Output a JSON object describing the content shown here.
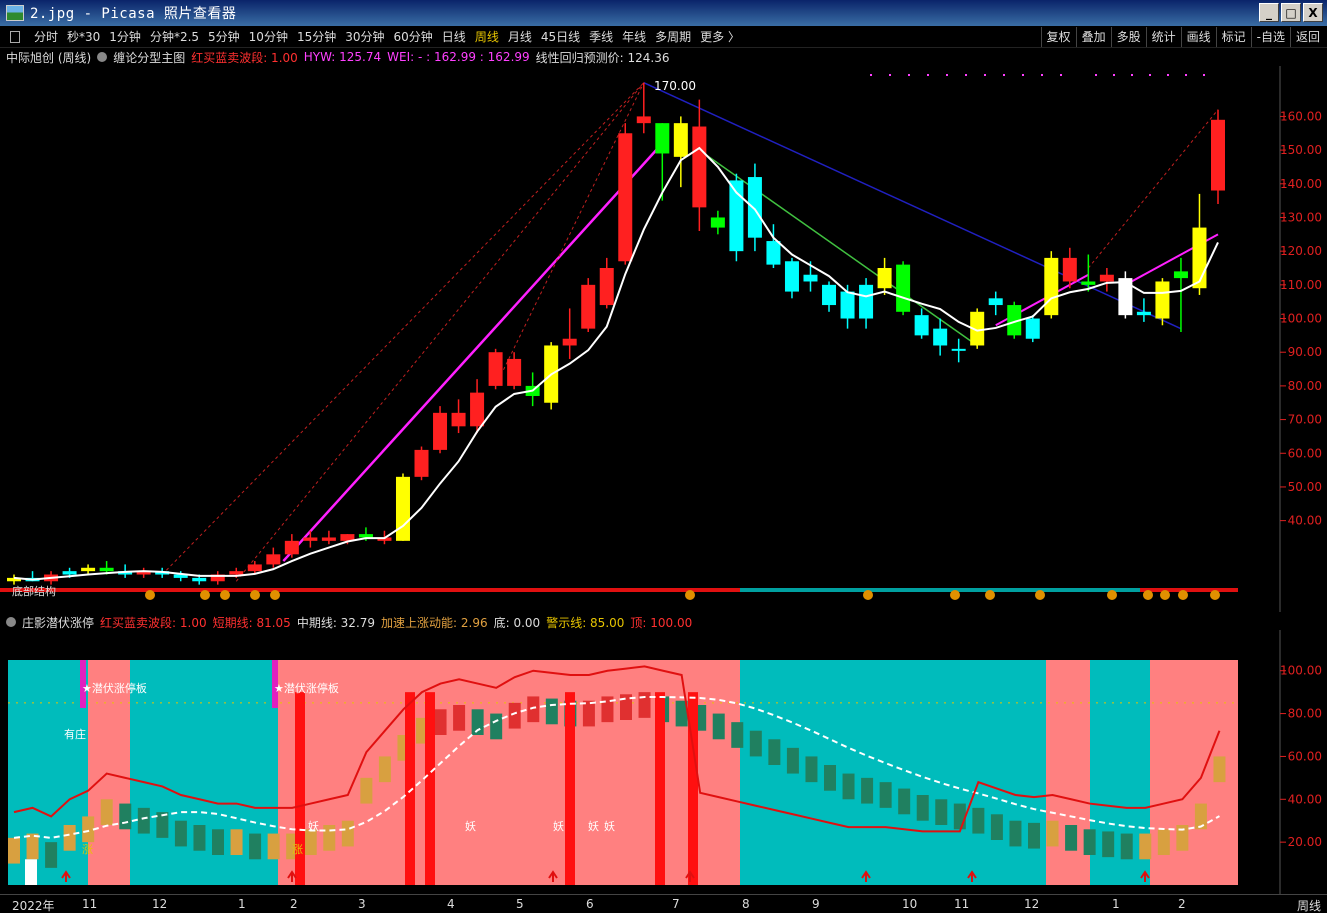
{
  "window": {
    "title": "2.jpg - Picasa 照片查看器",
    "minimize": "_",
    "maximize": "□",
    "close": "X"
  },
  "toolbar": {
    "periods": [
      "分时",
      "秒*30",
      "1分钟",
      "分钟*2.5",
      "5分钟",
      "10分钟",
      "15分钟",
      "30分钟",
      "60分钟",
      "日线",
      "周线",
      "月线",
      "45日线",
      "季线",
      "年线",
      "多周期",
      "更多 〉"
    ],
    "active_period": "周线",
    "right_tools": [
      "复权",
      "叠加",
      "多股",
      "统计",
      "画线",
      "标记",
      "-自选",
      "返回"
    ]
  },
  "main_info": {
    "stock": "中际旭创 (周线)",
    "indicator": "缠论分型主图",
    "hongmai": "红买蓝卖波段: 1.00",
    "hyw": "HYW: 125.74",
    "wei": "WEI: - : 162.99 : 162.99",
    "regress": "线性回归预测价: 124.36",
    "peak_label": "170.00"
  },
  "sub_info": {
    "indicator": "庄影潜伏涨停",
    "hongmai": "红买蓝卖波段: 1.00",
    "short": "短期线: 81.05",
    "mid": "中期线: 32.79",
    "accel": "加速上涨动能: 2.96",
    "bottom": "底: 0.00",
    "warn": "警示线: 85.00",
    "top": "顶: 100.00",
    "labels": [
      "★潜伏涨停板",
      "★潜伏涨停板",
      "有庄",
      "妖",
      "妖",
      "妖",
      "妖",
      "妖",
      "涨",
      "涨"
    ]
  },
  "colors": {
    "up": "#ff2020",
    "down": "#00ffff",
    "yellow": "#ffff00",
    "green": "#00ff00",
    "white": "#ffffff",
    "magenta": "#ff00ff",
    "cyan_bg": "#00bcbc",
    "pink_bg": "#ff8080"
  },
  "main_axis": [
    "160.00",
    "150.00",
    "140.00",
    "130.00",
    "120.00",
    "110.00",
    "100.00",
    "90.00",
    "80.00",
    "70.00",
    "60.00",
    "50.00",
    "40.00"
  ],
  "sub_axis": [
    "100.00",
    "80.00",
    "60.00",
    "40.00",
    "20.00"
  ],
  "x_axis": [
    "2022年",
    "11",
    "12",
    "1",
    "2",
    "3",
    "4",
    "5",
    "6",
    "7",
    "8",
    "9",
    "10",
    "11",
    "12",
    "1",
    "2"
  ],
  "period_label": "周线",
  "bottom_struct_label": "底部结构",
  "candles": [
    {
      "o": 22,
      "h": 24,
      "l": 21,
      "c": 23,
      "col": "yellow"
    },
    {
      "o": 23,
      "h": 25,
      "l": 22,
      "c": 22,
      "col": "down"
    },
    {
      "o": 22,
      "h": 25,
      "l": 21,
      "c": 24,
      "col": "up"
    },
    {
      "o": 24,
      "h": 26,
      "l": 23,
      "c": 25,
      "col": "down"
    },
    {
      "o": 25,
      "h": 27,
      "l": 24,
      "c": 26,
      "col": "yellow"
    },
    {
      "o": 26,
      "h": 28,
      "l": 24,
      "c": 25,
      "col": "green"
    },
    {
      "o": 25,
      "h": 27,
      "l": 23,
      "c": 24,
      "col": "down"
    },
    {
      "o": 24,
      "h": 26,
      "l": 23,
      "c": 25,
      "col": "up"
    },
    {
      "o": 25,
      "h": 26,
      "l": 23,
      "c": 24,
      "col": "down"
    },
    {
      "o": 24,
      "h": 25,
      "l": 22,
      "c": 23,
      "col": "down"
    },
    {
      "o": 23,
      "h": 24,
      "l": 21,
      "c": 22,
      "col": "down"
    },
    {
      "o": 22,
      "h": 25,
      "l": 21,
      "c": 24,
      "col": "up"
    },
    {
      "o": 24,
      "h": 26,
      "l": 23,
      "c": 25,
      "col": "up"
    },
    {
      "o": 25,
      "h": 28,
      "l": 24,
      "c": 27,
      "col": "up"
    },
    {
      "o": 27,
      "h": 32,
      "l": 26,
      "c": 30,
      "col": "up"
    },
    {
      "o": 30,
      "h": 36,
      "l": 29,
      "c": 34,
      "col": "up"
    },
    {
      "o": 34,
      "h": 37,
      "l": 32,
      "c": 35,
      "col": "up"
    },
    {
      "o": 35,
      "h": 37,
      "l": 33,
      "c": 34,
      "col": "up"
    },
    {
      "o": 34,
      "h": 36,
      "l": 33,
      "c": 36,
      "col": "up"
    },
    {
      "o": 36,
      "h": 38,
      "l": 34,
      "c": 35,
      "col": "green"
    },
    {
      "o": 35,
      "h": 37,
      "l": 33,
      "c": 34,
      "col": "up"
    },
    {
      "o": 34,
      "h": 54,
      "l": 34,
      "c": 53,
      "col": "yellow"
    },
    {
      "o": 53,
      "h": 62,
      "l": 52,
      "c": 61,
      "col": "up"
    },
    {
      "o": 61,
      "h": 74,
      "l": 60,
      "c": 72,
      "col": "up"
    },
    {
      "o": 72,
      "h": 76,
      "l": 66,
      "c": 68,
      "col": "up"
    },
    {
      "o": 68,
      "h": 82,
      "l": 66,
      "c": 78,
      "col": "up"
    },
    {
      "o": 80,
      "h": 91,
      "l": 79,
      "c": 90,
      "col": "up"
    },
    {
      "o": 88,
      "h": 90,
      "l": 79,
      "c": 80,
      "col": "up"
    },
    {
      "o": 80,
      "h": 84,
      "l": 74,
      "c": 77,
      "col": "green"
    },
    {
      "o": 75,
      "h": 93,
      "l": 73,
      "c": 92,
      "col": "yellow"
    },
    {
      "o": 92,
      "h": 103,
      "l": 88,
      "c": 94,
      "col": "up"
    },
    {
      "o": 97,
      "h": 112,
      "l": 96,
      "c": 110,
      "col": "up"
    },
    {
      "o": 104,
      "h": 118,
      "l": 103,
      "c": 115,
      "col": "up"
    },
    {
      "o": 117,
      "h": 158,
      "l": 116,
      "c": 155,
      "col": "up"
    },
    {
      "o": 160,
      "h": 170,
      "l": 155,
      "c": 158,
      "col": "up"
    },
    {
      "o": 158,
      "h": 158,
      "l": 135,
      "c": 149,
      "col": "green"
    },
    {
      "o": 148,
      "h": 160,
      "l": 139,
      "c": 158,
      "col": "yellow"
    },
    {
      "o": 157,
      "h": 165,
      "l": 126,
      "c": 133,
      "col": "up"
    },
    {
      "o": 130,
      "h": 132,
      "l": 125,
      "c": 127,
      "col": "green"
    },
    {
      "o": 141,
      "h": 143,
      "l": 117,
      "c": 120,
      "col": "down"
    },
    {
      "o": 142,
      "h": 146,
      "l": 120,
      "c": 124,
      "col": "down"
    },
    {
      "o": 123,
      "h": 128,
      "l": 115,
      "c": 116,
      "col": "down"
    },
    {
      "o": 117,
      "h": 118,
      "l": 106,
      "c": 108,
      "col": "down"
    },
    {
      "o": 113,
      "h": 117,
      "l": 108,
      "c": 111,
      "col": "down"
    },
    {
      "o": 110,
      "h": 111,
      "l": 102,
      "c": 104,
      "col": "down"
    },
    {
      "o": 108,
      "h": 110,
      "l": 97,
      "c": 100,
      "col": "down"
    },
    {
      "o": 100,
      "h": 112,
      "l": 97,
      "c": 110,
      "col": "down"
    },
    {
      "o": 109,
      "h": 118,
      "l": 107,
      "c": 115,
      "col": "yellow"
    },
    {
      "o": 116,
      "h": 117,
      "l": 101,
      "c": 102,
      "col": "green"
    },
    {
      "o": 101,
      "h": 103,
      "l": 94,
      "c": 95,
      "col": "down"
    },
    {
      "o": 97,
      "h": 100,
      "l": 89,
      "c": 92,
      "col": "down"
    },
    {
      "o": 91,
      "h": 94,
      "l": 87,
      "c": 91,
      "col": "down"
    },
    {
      "o": 92,
      "h": 103,
      "l": 91,
      "c": 102,
      "col": "yellow"
    },
    {
      "o": 104,
      "h": 108,
      "l": 101,
      "c": 106,
      "col": "down"
    },
    {
      "o": 95,
      "h": 105,
      "l": 94,
      "c": 104,
      "col": "green"
    },
    {
      "o": 94,
      "h": 101,
      "l": 93,
      "c": 100,
      "col": "down"
    },
    {
      "o": 101,
      "h": 120,
      "l": 100,
      "c": 118,
      "col": "yellow"
    },
    {
      "o": 118,
      "h": 121,
      "l": 109,
      "c": 111,
      "col": "up"
    },
    {
      "o": 110,
      "h": 119,
      "l": 108,
      "c": 111,
      "col": "green"
    },
    {
      "o": 111,
      "h": 115,
      "l": 108,
      "c": 113,
      "col": "up"
    },
    {
      "o": 112,
      "h": 114,
      "l": 100,
      "c": 101,
      "col": "white"
    },
    {
      "o": 101,
      "h": 106,
      "l": 99,
      "c": 102,
      "col": "down"
    },
    {
      "o": 100,
      "h": 112,
      "l": 98,
      "c": 111,
      "col": "yellow"
    },
    {
      "o": 112,
      "h": 118,
      "l": 96,
      "c": 114,
      "col": "green"
    },
    {
      "o": 109,
      "h": 137,
      "l": 107,
      "c": 127,
      "col": "yellow"
    },
    {
      "o": 138,
      "h": 162,
      "l": 134,
      "c": 159,
      "col": "up"
    }
  ],
  "sub_bars": [
    22,
    24,
    20,
    28,
    32,
    40,
    38,
    36,
    34,
    30,
    28,
    26,
    26,
    24,
    24,
    24,
    26,
    28,
    30,
    50,
    60,
    70,
    78,
    82,
    84,
    82,
    80,
    85,
    88,
    87,
    86,
    86,
    88,
    89,
    90,
    88,
    86,
    84,
    80,
    76,
    72,
    68,
    64,
    60,
    56,
    52,
    50,
    48,
    45,
    42,
    40,
    38,
    36,
    33,
    30,
    29,
    30,
    28,
    26,
    25,
    24,
    24,
    26,
    28,
    38,
    60
  ]
}
